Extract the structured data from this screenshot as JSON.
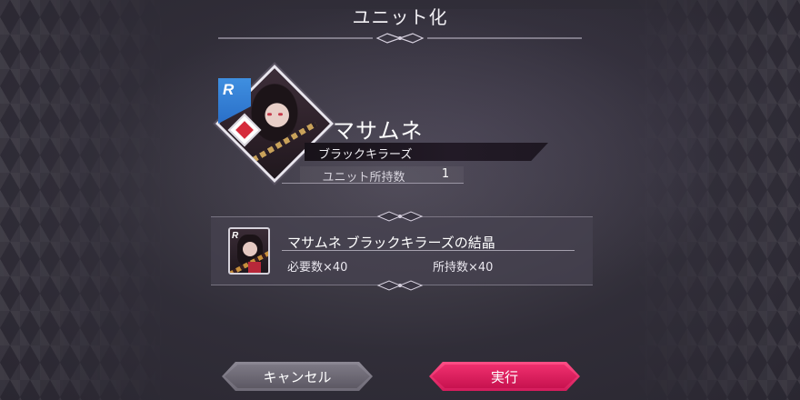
{
  "screen": {
    "title": "ユニット化"
  },
  "character": {
    "rank_letter": "R",
    "name": "マサムネ",
    "subtitle": "ブラックキラーズ",
    "owned_label": "ユニット所持数",
    "owned_value": "1"
  },
  "material": {
    "rank_letter": "R",
    "name": "マサムネ ブラックキラーズの結晶",
    "required": "必要数×40",
    "owned": "所持数×40"
  },
  "buttons": {
    "cancel_label": "キャンセル",
    "execute_label": "実行"
  },
  "colors": {
    "accent_execute": "#e8266a",
    "rank_badge": "#3f8fe0",
    "attribute": "#d62c3c"
  }
}
